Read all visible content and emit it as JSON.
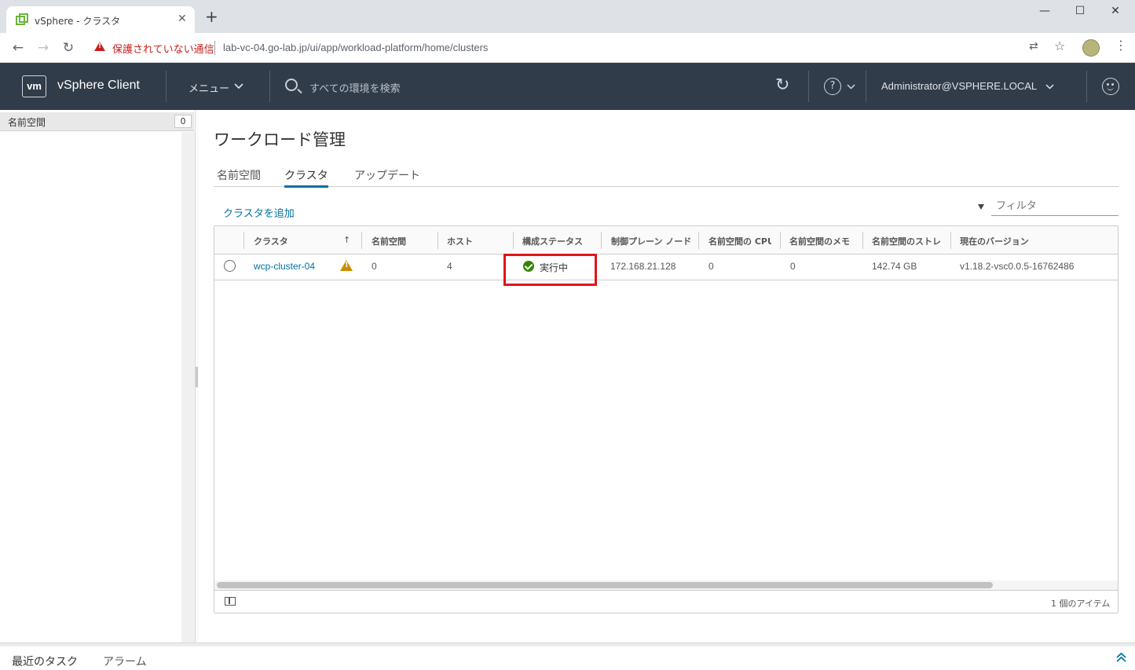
{
  "browser": {
    "tab_title": "vSphere - クラスタ",
    "url_warning": "保護されていない通信",
    "url": "lab-vc-04.go-lab.jp/ui/app/workload-platform/home/clusters"
  },
  "header": {
    "logo": "vm",
    "app_title": "vSphere Client",
    "menu_label": "メニュー",
    "search_placeholder": "すべての環境を検索",
    "user": "Administrator@VSPHERE.LOCAL"
  },
  "left_panel": {
    "title": "名前空間",
    "count": "0"
  },
  "main": {
    "page_title": "ワークロード管理",
    "tabs": [
      {
        "label": "名前空間",
        "active": false
      },
      {
        "label": "クラスタ",
        "active": true
      },
      {
        "label": "アップデート",
        "active": false
      }
    ],
    "add_cluster": "クラスタを追加",
    "filter_placeholder": "フィルタ"
  },
  "grid": {
    "columns": [
      "クラスタ",
      "名前空間",
      "ホスト",
      "構成ステータス",
      "制御プレーン ノード",
      "名前空間の CPU",
      "名前空間のメモ",
      "名前空間のストレ",
      "現在のバージョン"
    ],
    "rows": [
      {
        "cluster": "wcp-cluster-04",
        "namespaces": "0",
        "hosts": "4",
        "status": "実行中",
        "control_plane": "172.168.21.128",
        "cpu": "0",
        "memory": "0",
        "storage": "142.74 GB",
        "version": "v1.18.2-vsc0.0.5-16762486"
      }
    ],
    "footer_count": "1 個のアイテム"
  },
  "bottom": {
    "tasks": "最近のタスク",
    "alarms": "アラーム"
  },
  "colors": {
    "header_bg": "#313c4a",
    "link": "#0072a3",
    "status_ok": "#318700",
    "warning": "#c98e00",
    "highlight": "#e1141a"
  }
}
